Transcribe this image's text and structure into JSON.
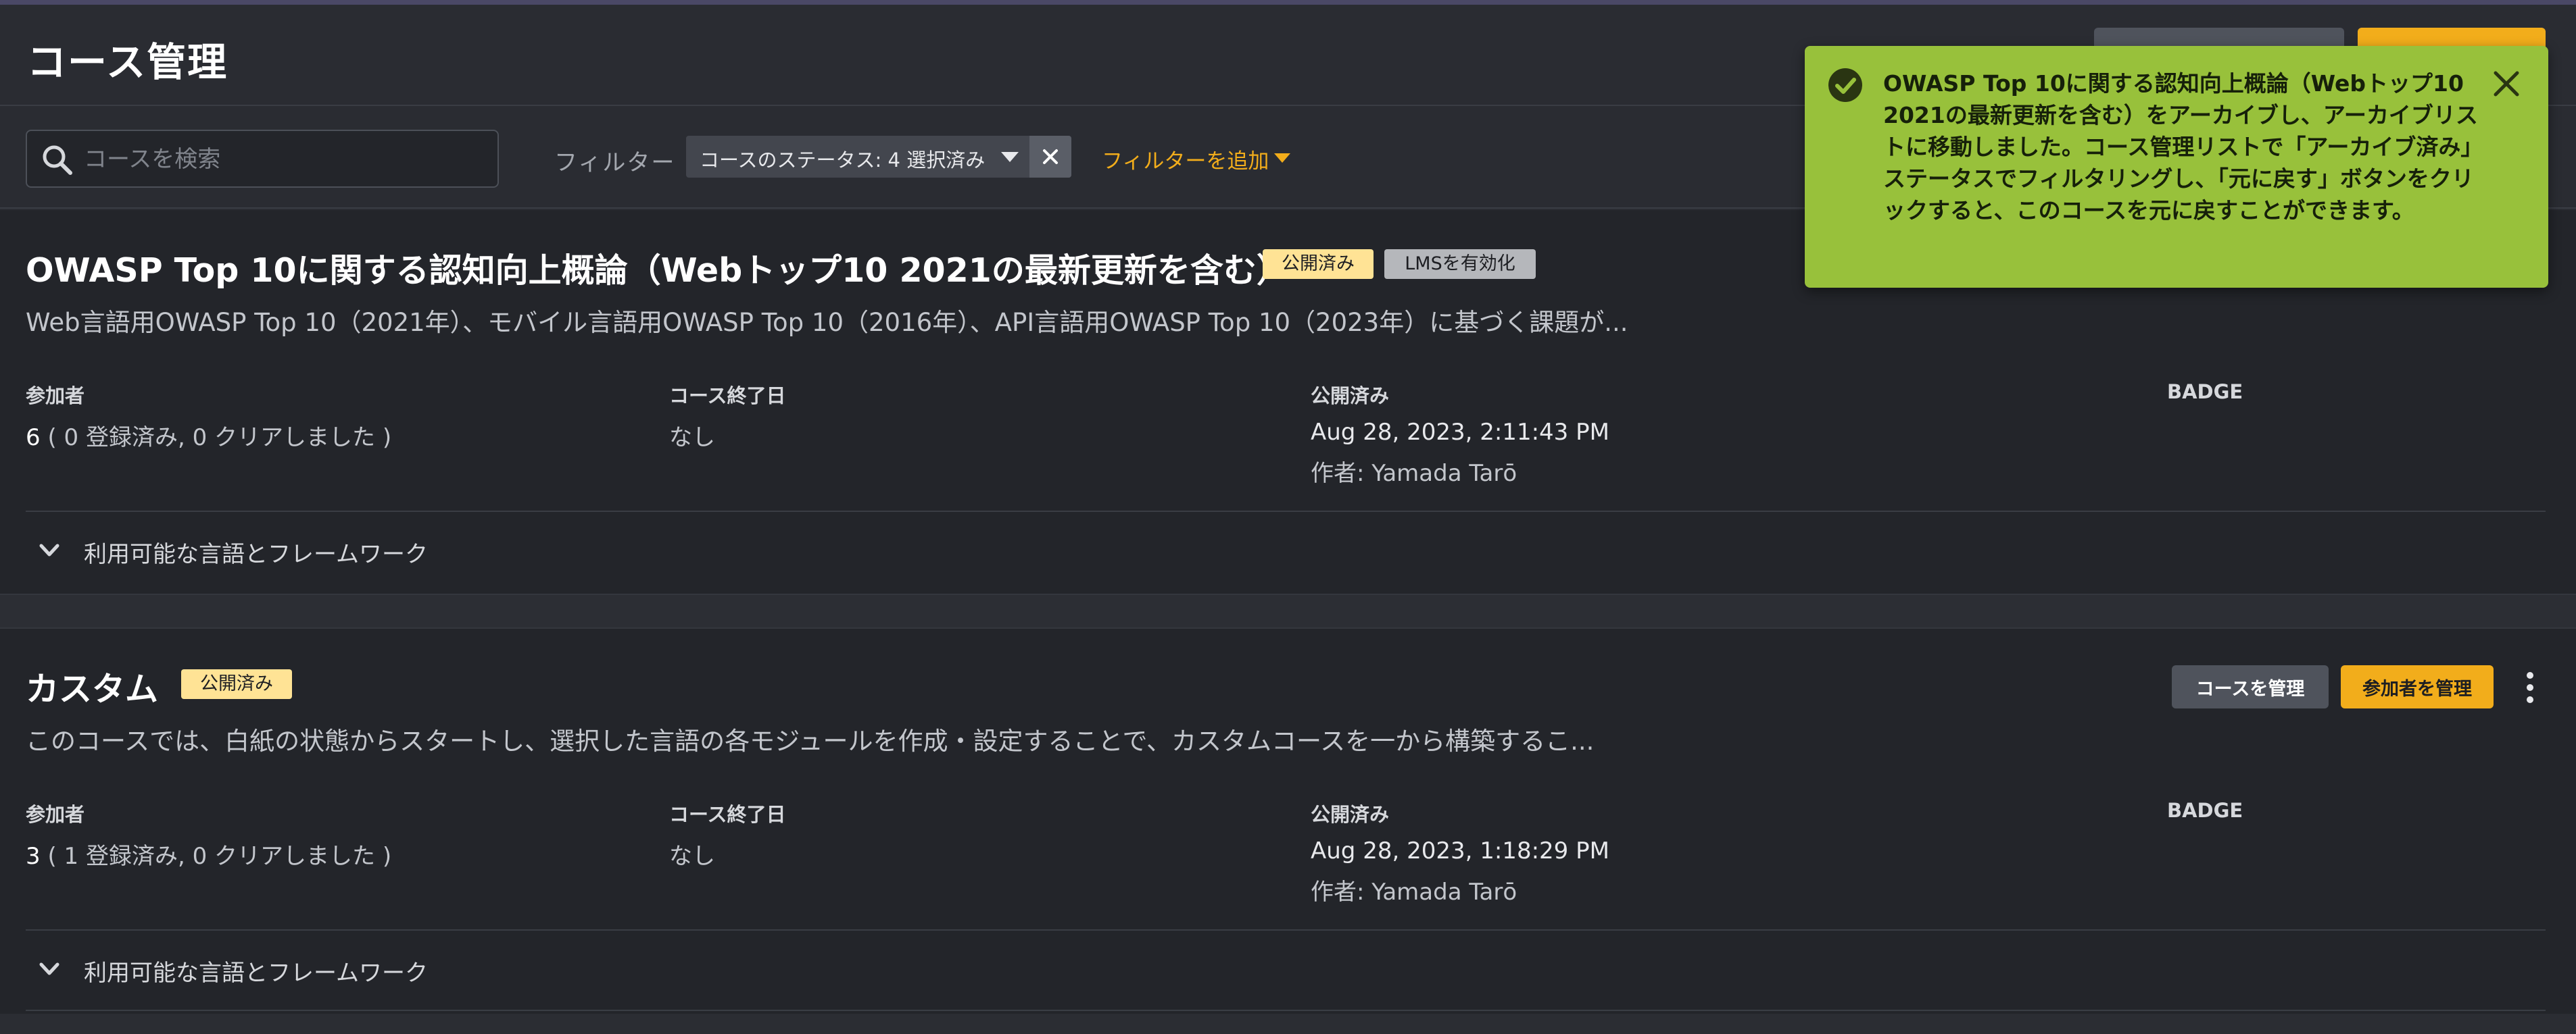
{
  "header": {
    "title": "コース管理"
  },
  "filterbar": {
    "search_placeholder": "コースを検索",
    "filter_label": "フィルター",
    "status_chip": "コースのステータス: 4 選択済み",
    "add_filter": "フィルターを追加"
  },
  "toast": {
    "message": "OWASP Top 10に関する認知向上概論（Webトップ10 2021の最新更新を含む）をアーカイブし、アーカイブリストに移動しました。コース管理リストで「アーカイブ済み」ステータスでフィルタリングし、「元に戻す」ボタンをクリックすると、このコースを元に戻すことができます。"
  },
  "labels": {
    "participants": "参加者",
    "end_date": "コース終了日",
    "published": "公開済み",
    "badge": "BADGE",
    "languages": "利用可能な言語とフレームワーク",
    "manage_course": "コースを管理",
    "manage_participants": "参加者を管理"
  },
  "courses": [
    {
      "title": "OWASP Top 10に関する認知向上概論（Webトップ10 2021の最新更新を含む）",
      "badges": [
        "公開済み",
        "LMSを有効化"
      ],
      "description": "Web言語用OWASP Top 10（2021年）、モバイル言語用OWASP Top 10（2016年）、API言語用OWASP Top 10（2023年）に基づく課題が...",
      "participants_count": "6",
      "participants_detail": "( 0 登録済み, 0 クリアしました )",
      "end_date": "なし",
      "published_date": "Aug 28, 2023, 2:11:43 PM",
      "author": "作者: Yamada Tarō"
    },
    {
      "title": "カスタム",
      "badges": [
        "公開済み"
      ],
      "description": "このコースでは、白紙の状態からスタートし、選択した言語の各モジュールを作成・設定することで、カスタムコースを一から構築するこ...",
      "participants_count": "3",
      "participants_detail": "( 1 登録済み, 0 クリアしました )",
      "end_date": "なし",
      "published_date": "Aug 28, 2023, 1:18:29 PM",
      "author": "作者: Yamada Tarō"
    }
  ],
  "colors": {
    "accent": "#f2ad1b",
    "toast_bg": "#98c13b",
    "badge_published": "#ffe395",
    "badge_lms": "#b5b7bb"
  }
}
